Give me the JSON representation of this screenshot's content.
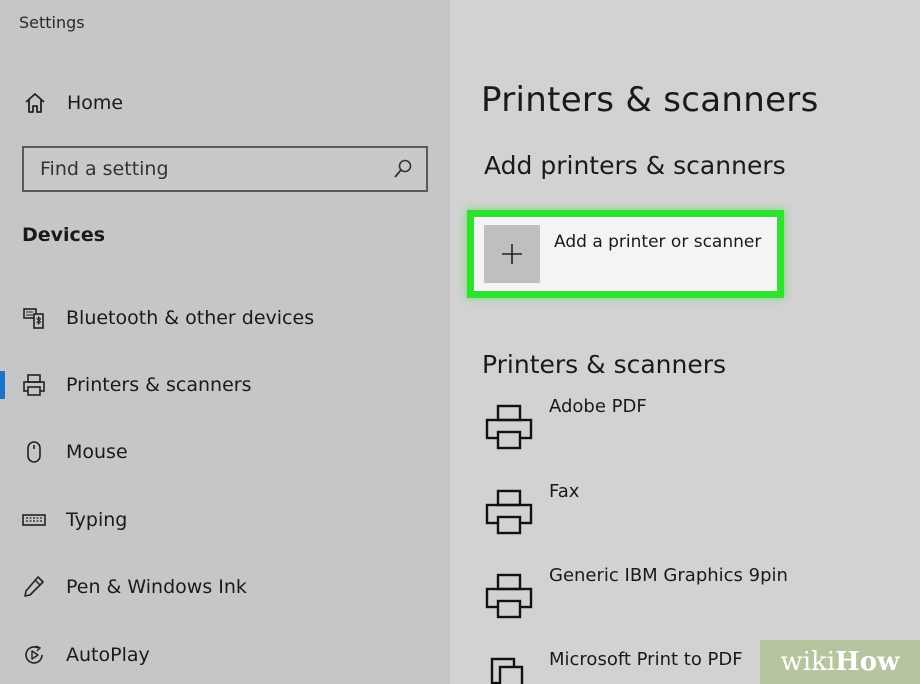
{
  "app": {
    "title": "Settings"
  },
  "sidebar": {
    "home_label": "Home",
    "search": {
      "placeholder": "Find a setting",
      "value": ""
    },
    "section_heading": "Devices",
    "items": [
      {
        "label": "Bluetooth & other devices",
        "icon": "bluetooth-devices-icon",
        "selected": false
      },
      {
        "label": "Printers & scanners",
        "icon": "printer-icon",
        "selected": true
      },
      {
        "label": "Mouse",
        "icon": "mouse-icon",
        "selected": false
      },
      {
        "label": "Typing",
        "icon": "keyboard-icon",
        "selected": false
      },
      {
        "label": "Pen & Windows Ink",
        "icon": "pen-icon",
        "selected": false
      },
      {
        "label": "AutoPlay",
        "icon": "autoplay-icon",
        "selected": false
      }
    ]
  },
  "main": {
    "title": "Printers & scanners",
    "add_section_heading": "Add printers & scanners",
    "add_button_label": "Add a printer or scanner",
    "list_heading": "Printers & scanners",
    "printers": [
      {
        "name": "Adobe PDF"
      },
      {
        "name": "Fax"
      },
      {
        "name": "Generic IBM Graphics 9pin"
      },
      {
        "name": "Microsoft Print to PDF"
      }
    ]
  },
  "watermark": {
    "part1": "wiki",
    "part2": "How"
  },
  "colors": {
    "highlight": "#2fe22f",
    "selection_indicator": "#1a73c8"
  }
}
